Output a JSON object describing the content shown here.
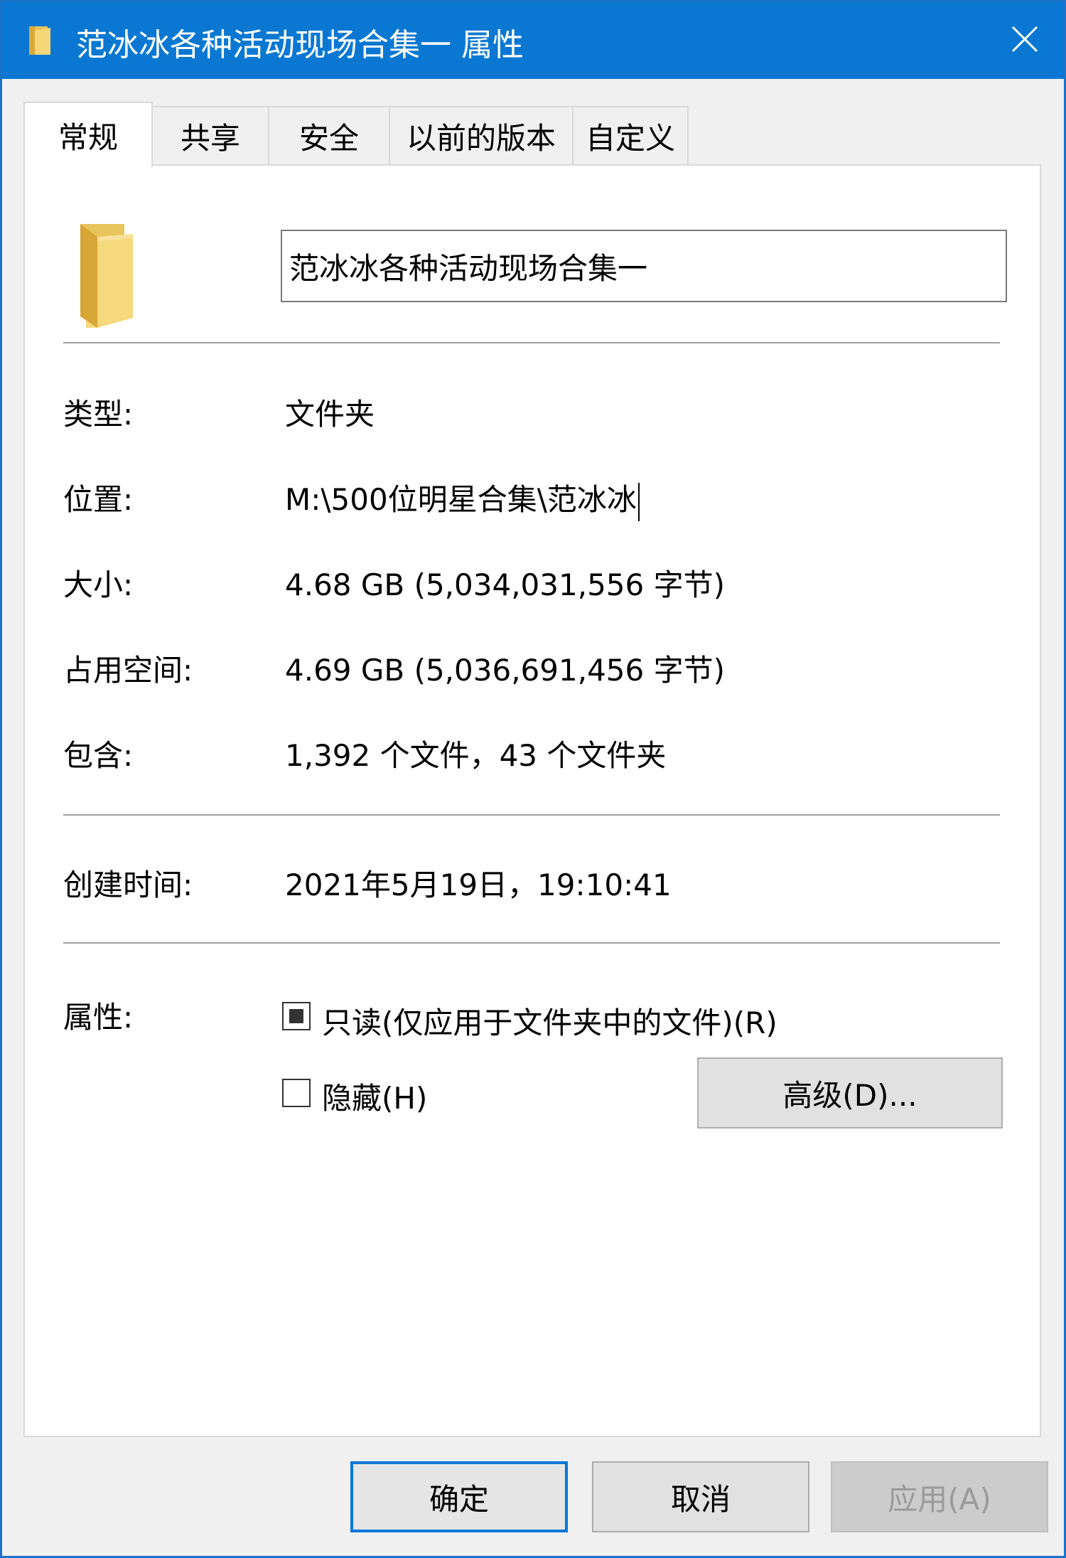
{
  "window": {
    "title": "范冰冰各种活动现场合集一 属性"
  },
  "tabs": [
    {
      "label": "常规",
      "active": true
    },
    {
      "label": "共享",
      "active": false
    },
    {
      "label": "安全",
      "active": false
    },
    {
      "label": "以前的版本",
      "active": false
    },
    {
      "label": "自定义",
      "active": false
    }
  ],
  "general": {
    "folder_name": "范冰冰各种活动现场合集一",
    "rows": {
      "type": {
        "label": "类型:",
        "value": "文件夹"
      },
      "location": {
        "label": "位置:",
        "value": "M:\\500位明星合集\\范冰冰"
      },
      "size": {
        "label": "大小:",
        "value": "4.68 GB (5,034,031,556 字节)"
      },
      "size_on_disk": {
        "label": "占用空间:",
        "value": "4.69 GB (5,036,691,456 字节)"
      },
      "contains": {
        "label": "包含:",
        "value": "1,392 个文件，43 个文件夹"
      },
      "created": {
        "label": "创建时间:",
        "value": "2021年5月19日，19:10:41"
      }
    },
    "attributes": {
      "label": "属性:",
      "readonly": {
        "label": "只读(仅应用于文件夹中的文件)(R)",
        "state": "indeterminate"
      },
      "hidden": {
        "label": "隐藏(H)",
        "state": "unchecked"
      },
      "advanced_button": "高级(D)..."
    }
  },
  "buttons": {
    "ok": "确定",
    "cancel": "取消",
    "apply": "应用(A)"
  },
  "colors": {
    "titlebar": "#0a78d2",
    "accent": "#0078d7",
    "folder": "#e8c25a"
  }
}
